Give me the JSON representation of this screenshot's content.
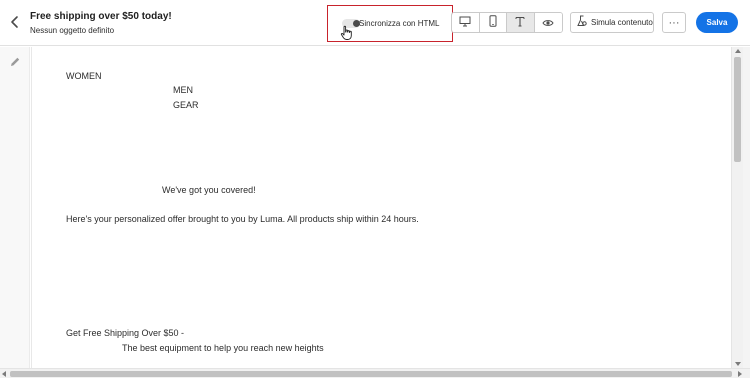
{
  "header": {
    "title": "Free shipping over $50 today!",
    "subtitle": "Nessun oggetto definito",
    "back_icon": "chevron-left-icon"
  },
  "sync": {
    "label": "Sincronizza con HTML",
    "enabled": false,
    "highlight_color": "#c8232c"
  },
  "view_modes": [
    {
      "icon": "desktop-icon",
      "active": false
    },
    {
      "icon": "mobile-icon",
      "active": false
    },
    {
      "icon": "text-icon",
      "active": true
    },
    {
      "icon": "eye-icon",
      "active": false
    }
  ],
  "toolbar": {
    "simulate_label": "Simula contenuto",
    "more_label": "···",
    "save_label": "Salva",
    "save_color": "#1473e6"
  },
  "email": {
    "nav_women": "WOMEN",
    "nav_men": "MEN",
    "nav_gear": "GEAR",
    "headline": "We've got you covered!",
    "offer_text": "Here's your personalized offer brought to you by Luma. All products ship within 24 hours.",
    "shipping_title": "Get Free Shipping Over $50 -",
    "shipping_sub": "The best equipment to help you reach new heights"
  }
}
